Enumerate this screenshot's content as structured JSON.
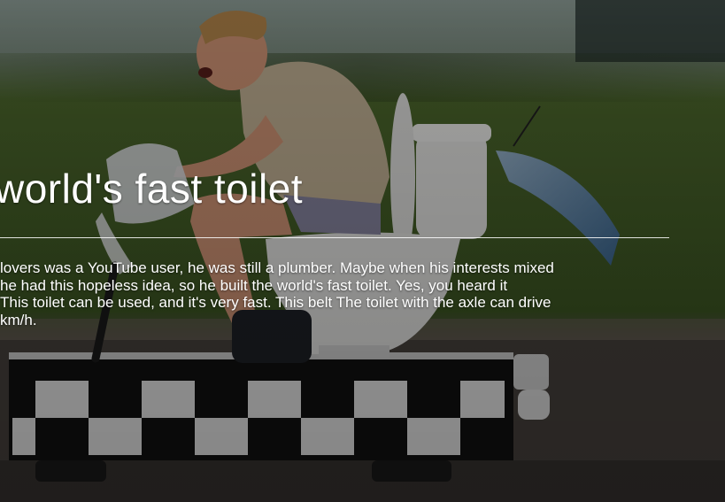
{
  "slide": {
    "title": "world's fast toilet",
    "paragraph_lines": [
      "lovers was a YouTube user, he was still a plumber. Maybe when his interests mixed",
      "he had this hopeless idea, so he built the world's fast toilet. Yes, you heard it",
      "This toilet can be used, and it's very fast. This belt The toilet with the axle can drive",
      "km/h."
    ]
  },
  "photo": {
    "subject": "man riding a motorized toilet on a checkered cart",
    "colors": {
      "grass": "#4f6b2e",
      "track": "#5a544e",
      "skin": "#d89a7a",
      "shirt": "#c9b89a",
      "porcelain": "#eeeeec",
      "cart_black": "#111111",
      "cart_white": "#f2f2f2"
    }
  }
}
